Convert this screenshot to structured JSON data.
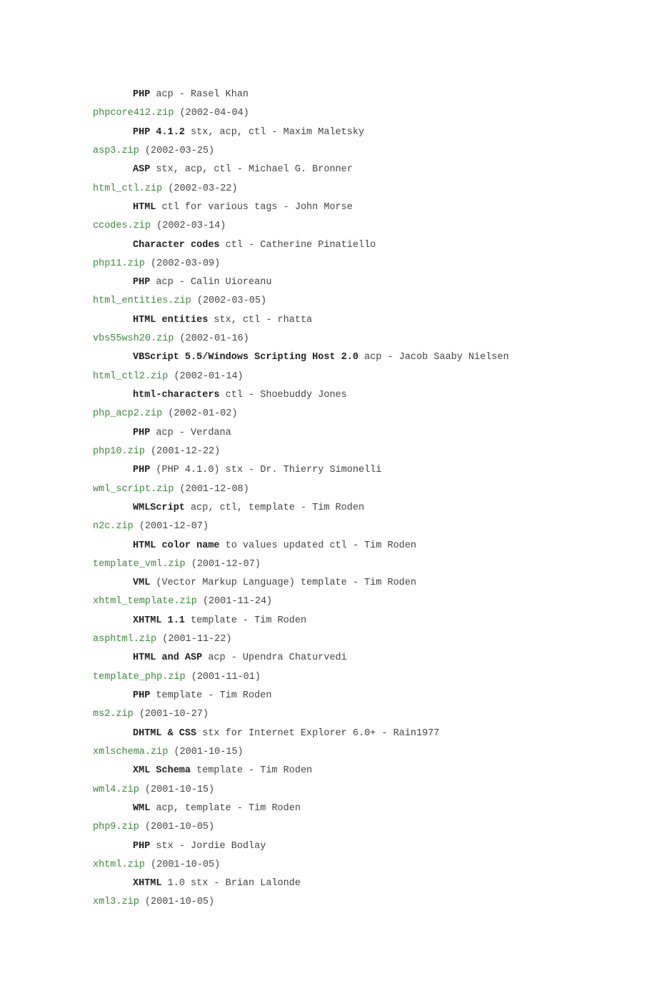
{
  "entries": [
    {
      "link": null,
      "date": null,
      "bold": "PHP",
      "rest": " acp - Rasel Khan"
    },
    {
      "link": "phpcore412.zip",
      "date": "(2002-04-04)",
      "bold": "PHP 4.1.2",
      "rest": " stx, acp, ctl - Maxim Maletsky"
    },
    {
      "link": "asp3.zip",
      "date": "(2002-03-25)",
      "bold": "ASP",
      "rest": " stx, acp, ctl - Michael G. Bronner"
    },
    {
      "link": "html_ctl.zip",
      "date": "(2002-03-22)",
      "bold": "HTML",
      "rest": " ctl for various tags - John Morse"
    },
    {
      "link": "ccodes.zip",
      "date": "(2002-03-14)",
      "bold": "Character codes",
      "rest": " ctl - Catherine Pinatiello"
    },
    {
      "link": "php11.zip",
      "date": "(2002-03-09)",
      "bold": "PHP",
      "rest": " acp - Calin Uioreanu"
    },
    {
      "link": "html_entities.zip",
      "date": "(2002-03-05)",
      "bold": "HTML entities",
      "rest": " stx, ctl - rhatta"
    },
    {
      "link": "vbs55wsh20.zip",
      "date": "(2002-01-16)",
      "bold": "VBScript 5.5/Windows Scripting Host 2.0",
      "rest": " acp - Jacob Saaby Nielsen"
    },
    {
      "link": "html_ctl2.zip",
      "date": "(2002-01-14)",
      "bold": "html-characters",
      "rest": " ctl - Shoebuddy Jones"
    },
    {
      "link": "php_acp2.zip",
      "date": "(2002-01-02)",
      "bold": "PHP",
      "rest": " acp - Verdana"
    },
    {
      "link": "php10.zip",
      "date": "(2001-12-22)",
      "bold": "PHP",
      "rest": " (PHP 4.1.0) stx - Dr. Thierry Simonelli"
    },
    {
      "link": "wml_script.zip",
      "date": "(2001-12-08)",
      "bold": "WMLScript",
      "rest": " acp, ctl, template - Tim Roden"
    },
    {
      "link": "n2c.zip",
      "date": "(2001-12-07)",
      "bold": "HTML color name",
      "rest": " to values updated ctl - Tim Roden"
    },
    {
      "link": "template_vml.zip",
      "date": "(2001-12-07)",
      "bold": "VML",
      "rest": " (Vector Markup Language) template - Tim Roden"
    },
    {
      "link": "xhtml_template.zip",
      "date": "(2001-11-24)",
      "bold": "XHTML 1.1",
      "rest": " template - Tim Roden"
    },
    {
      "link": "asphtml.zip",
      "date": "(2001-11-22)",
      "bold": "HTML and ASP",
      "rest": " acp - Upendra Chaturvedi"
    },
    {
      "link": "template_php.zip",
      "date": "(2001-11-01)",
      "bold": "PHP",
      "rest": " template - Tim Roden"
    },
    {
      "link": "ms2.zip",
      "date": "(2001-10-27)",
      "bold": "DHTML & CSS",
      "rest": " stx for Internet Explorer 6.0+ - Rain1977"
    },
    {
      "link": "xmlschema.zip",
      "date": "(2001-10-15)",
      "bold": "XML Schema",
      "rest": " template - Tim Roden"
    },
    {
      "link": "wml4.zip",
      "date": "(2001-10-15)",
      "bold": "WML",
      "rest": " acp, template - Tim Roden"
    },
    {
      "link": "php9.zip",
      "date": "(2001-10-05)",
      "bold": "PHP",
      "rest": " stx - Jordie Bodlay"
    },
    {
      "link": "xhtml.zip",
      "date": "(2001-10-05)",
      "bold": "XHTML",
      "rest": " 1.0 stx - Brian Lalonde"
    },
    {
      "link": "xml3.zip",
      "date": "(2001-10-05)",
      "bold": null,
      "rest": null
    }
  ]
}
